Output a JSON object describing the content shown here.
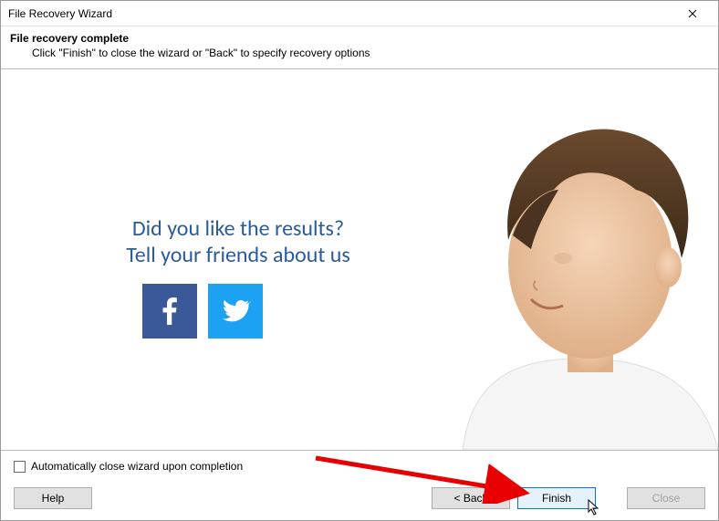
{
  "window": {
    "title": "File Recovery Wizard"
  },
  "header": {
    "title": "File recovery complete",
    "subtitle": "Click \"Finish\" to close the wizard or \"Back\" to specify recovery options"
  },
  "promo": {
    "line1": "Did you like the results?",
    "line2": "Tell your friends about us",
    "facebook_icon": "facebook-icon",
    "twitter_icon": "twitter-icon"
  },
  "footer": {
    "checkbox_label": "Automatically close wizard upon completion",
    "checkbox_checked": false
  },
  "buttons": {
    "help": "Help",
    "back": "< Back",
    "finish": "Finish",
    "close": "Close"
  },
  "colors": {
    "promo_text": "#2a5b9c",
    "facebook": "#3b5998",
    "twitter": "#1da1f2",
    "primary_border": "#0078d7"
  }
}
